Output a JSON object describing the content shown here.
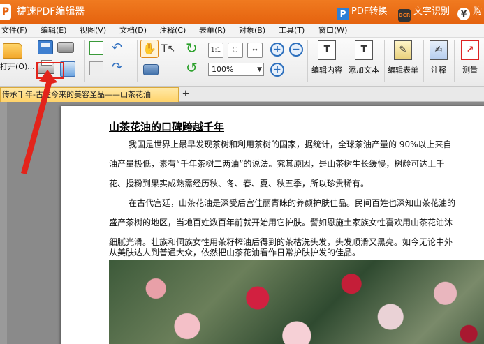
{
  "titlebar": {
    "logo_letter": "P",
    "title": "捷速PDF编辑器",
    "pdf_convert_icon": "P",
    "pdf_convert_label": "PDF转换",
    "ocr_icon": "OCR",
    "ocr_label": "文字识别",
    "pay_icon": "¥",
    "pay_label": "购"
  },
  "menu": {
    "items": [
      "文件(F)",
      "编辑(E)",
      "视图(V)",
      "文档(D)",
      "注释(C)",
      "表单(R)",
      "对象(B)",
      "工具(T)",
      "窗口(W)"
    ]
  },
  "toolbar": {
    "open_label": "打开(O)...",
    "zoom_value": "100%",
    "edit_content_label": "编辑内容",
    "add_text_label": "添加文本",
    "edit_form_label": "编辑表单",
    "annotate_label": "注释",
    "measure_label": "测量"
  },
  "tab": {
    "label": "传承千年-古往今来的美容圣品——山茶花油"
  },
  "document": {
    "title": "山茶花油的口碑跨越千年",
    "lines": [
      "我国是世界上最早发现茶树和利用茶树的国家，据统计，全球茶油产量的 90%以上来自",
      "油产量极低，素有“千年茶树二两油”的说法。究其原因，是山茶树生长缓慢，树龄可达上千",
      "花、授粉到果实成熟需经历秋、冬、春、夏、秋五季，所以珍贵稀有。",
      "在古代宫廷，山茶花油是深受后宫佳丽青睐的养颜护肤佳品。民间百姓也深知山茶花油的",
      "盛产茶树的地区，当地百姓数百年前就开始用它护肤。譬如恩施土家族女性喜欢用山茶花油沐",
      "细腻光滑。壮族和侗族女性用茶籽榨油后得到的茶枯洗头发，头发顺滑又黑亮。如今无论中外",
      "从美肤达人到普通大众，依然把山茶花油看作日常护肤护发的佳品。"
    ]
  },
  "colors": {
    "titlebar": "#e5630f",
    "highlight": "#e3241b",
    "tab_active": "#ffd36a"
  }
}
